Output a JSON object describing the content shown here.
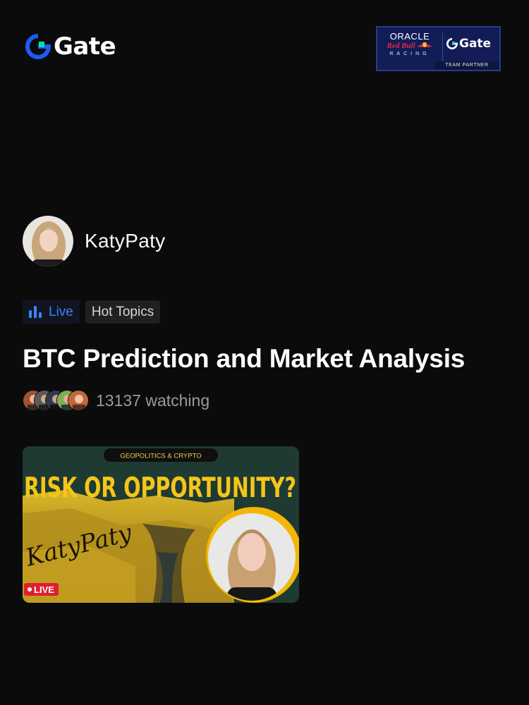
{
  "brand": {
    "name": "Gate",
    "accent": "#00e1ae",
    "blue": "#1d5bf2"
  },
  "partner_badge": {
    "oracle": "ORACLE",
    "redbull": "Red Bull",
    "racing": "RACING",
    "gate": "Gate",
    "team_partner": "TEAM PARTNER"
  },
  "host": {
    "name": "KatyPaty",
    "avatar_icon": "host-avatar"
  },
  "tags": {
    "live_icon": "bar-chart-icon",
    "live": "Live",
    "topic": "Hot Topics"
  },
  "stream": {
    "title": "BTC Prediction and Market Analysis"
  },
  "viewers": {
    "count_text": "13137 watching",
    "avatar_count": 5
  },
  "thumbnail": {
    "kicker": "GEOPOLITICS & CRYPTO",
    "headline": "RISK OR OPPORTUNITY?",
    "signature": "KatyPaty",
    "live_badge": "LIVE",
    "headline_color": "#f5c518",
    "live_color": "#e11d2e"
  }
}
